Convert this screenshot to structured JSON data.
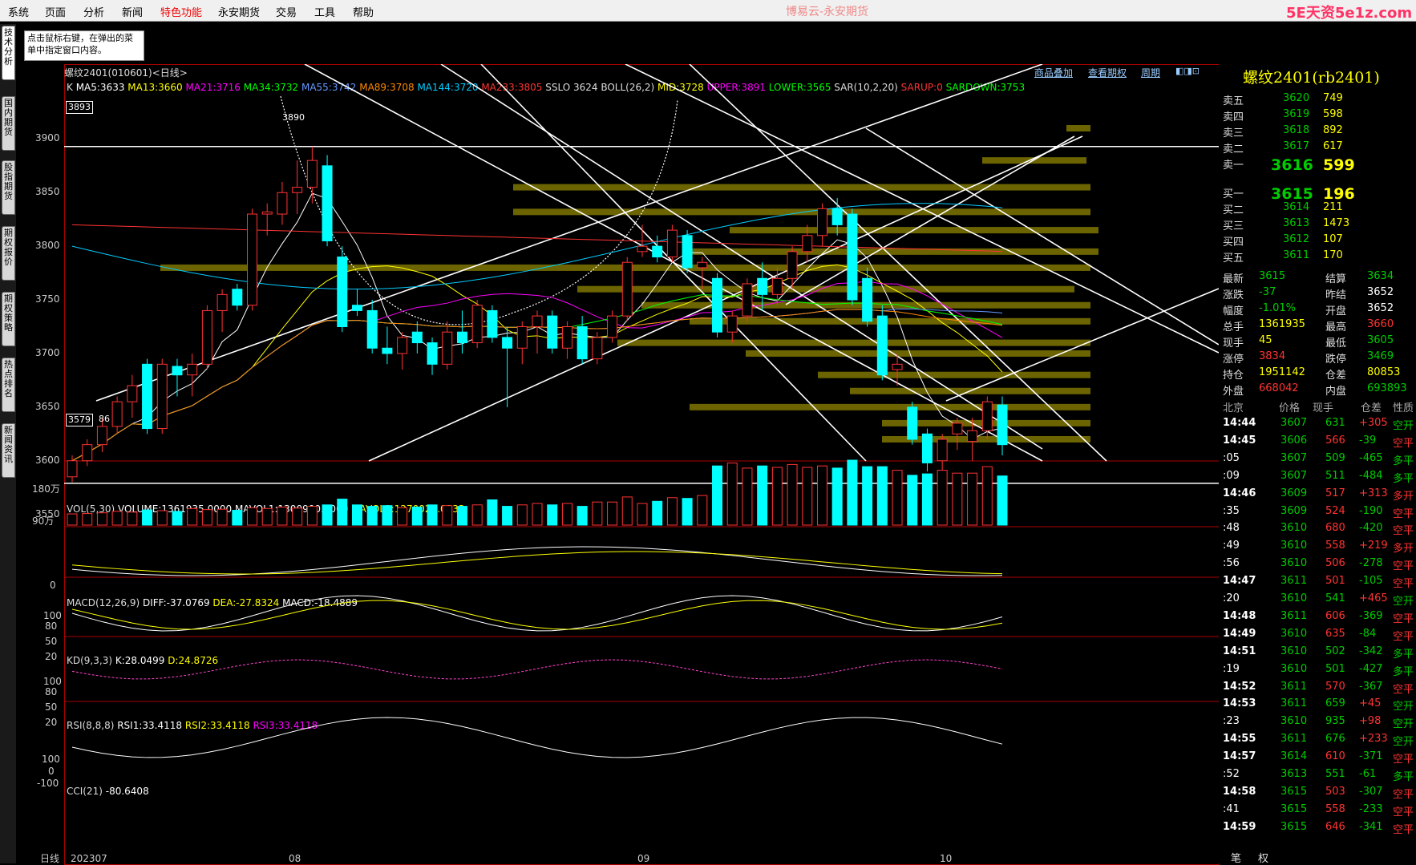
{
  "menu": {
    "items": [
      "系统",
      "页面",
      "分析",
      "新闻",
      "特色功能",
      "永安期货",
      "交易",
      "工具",
      "帮助"
    ],
    "highlight_index": 4,
    "app_title": "博易云-永安期货",
    "brand": "5E天资5e1z.com"
  },
  "hint": {
    "text": "点击鼠标右键，在弹出的菜单中指定窗口内容。"
  },
  "sidetabs": [
    "技术分析",
    "国内期货",
    "股指期货",
    "期权报价",
    "期权策略",
    "热点排名",
    "新闻资讯"
  ],
  "chart": {
    "title": "螺纹2401(010601)<日线>",
    "links": [
      "商品叠加",
      "查看期权",
      "周期"
    ],
    "indicators": [
      {
        "text": "K",
        "color": "#dddddd"
      },
      {
        "text": "MA5:3633",
        "color": "#ffffff"
      },
      {
        "text": "MA13:3660",
        "color": "#ffff00"
      },
      {
        "text": "MA21:3716",
        "color": "#ff00ff"
      },
      {
        "text": "MA34:3732",
        "color": "#00ff00"
      },
      {
        "text": "MA55:3742",
        "color": "#6699ff"
      },
      {
        "text": "MA89:3708",
        "color": "#ff8800"
      },
      {
        "text": "MA144:3720",
        "color": "#00ccff"
      },
      {
        "text": "MA233:3805",
        "color": "#ff3333"
      },
      {
        "text": "SSLO 3624",
        "color": "#dddddd"
      },
      {
        "text": "BOLL(26,2)",
        "color": "#dddddd"
      },
      {
        "text": "MID:3728",
        "color": "#ffff00"
      },
      {
        "text": "UPPER:3891",
        "color": "#ff00ff"
      },
      {
        "text": "LOWER:3565",
        "color": "#00ff00"
      },
      {
        "text": "SAR(10,2,20)",
        "color": "#dddddd"
      },
      {
        "text": "SARUP:0",
        "color": "#ff3333"
      },
      {
        "text": "SARDOWN:3753",
        "color": "#00ff00"
      }
    ],
    "price_axis": [
      "3900",
      "3850",
      "3800",
      "3750",
      "3700",
      "3650",
      "3600",
      "3550"
    ],
    "high_label": "3893",
    "high_marker": "3890",
    "low_label": "3579",
    "low_marker": "86",
    "vol_label": [
      {
        "text": "VOL(5,30)",
        "color": "#dddddd"
      },
      {
        "text": "VOLUME:1361935.0000",
        "color": "#ffffff"
      },
      {
        "text": "MAVOL1:1300900.8000",
        "color": "#ffffff"
      },
      {
        "text": "MAVOL2:1270022.0333",
        "color": "#ffff00"
      }
    ],
    "vol_axis": [
      "180万",
      "90万"
    ],
    "macd_label": [
      {
        "text": "MACD(12,26,9)",
        "color": "#dddddd"
      },
      {
        "text": "DIFF:-37.0769",
        "color": "#ffffff"
      },
      {
        "text": "DEA:-27.8324",
        "color": "#ffff00"
      },
      {
        "text": "MACD:-18.4889",
        "color": "#ffffff"
      }
    ],
    "macd_axis": [
      "0"
    ],
    "kd_label": [
      {
        "text": "KD(9,3,3)",
        "color": "#dddddd"
      },
      {
        "text": "K:28.0499",
        "color": "#ffffff"
      },
      {
        "text": "D:24.8726",
        "color": "#ffff00"
      }
    ],
    "kd_axis": [
      "100",
      "80",
      "50",
      "20"
    ],
    "rsi_label": [
      {
        "text": "RSI(8,8,8)",
        "color": "#dddddd"
      },
      {
        "text": "RSI1:33.4118",
        "color": "#ffffff"
      },
      {
        "text": "RSI2:33.4118",
        "color": "#ffff00"
      },
      {
        "text": "RSI3:33.4118",
        "color": "#ff00ff"
      }
    ],
    "rsi_axis": [
      "100",
      "80",
      "50",
      "20"
    ],
    "cci_label": [
      {
        "text": "CCI(21)",
        "color": "#dddddd"
      },
      {
        "text": "-80.6408",
        "color": "#ffffff"
      }
    ],
    "cci_axis": [
      "100",
      "0",
      "-100"
    ],
    "date_axis": {
      "period": "日线",
      "labels": [
        "202307",
        "08",
        "09",
        "10"
      ]
    }
  },
  "quote": {
    "title": "螺纹2401(rb2401)",
    "asks": [
      {
        "label": "卖五",
        "price": "3620",
        "vol": "749"
      },
      {
        "label": "卖四",
        "price": "3619",
        "vol": "598"
      },
      {
        "label": "卖三",
        "price": "3618",
        "vol": "892"
      },
      {
        "label": "卖二",
        "price": "3617",
        "vol": "617"
      },
      {
        "label": "卖一",
        "price": "3616",
        "vol": "599"
      }
    ],
    "bids": [
      {
        "label": "买一",
        "price": "3615",
        "vol": "196"
      },
      {
        "label": "买二",
        "price": "3614",
        "vol": "211"
      },
      {
        "label": "买三",
        "price": "3613",
        "vol": "1473"
      },
      {
        "label": "买四",
        "price": "3612",
        "vol": "107"
      },
      {
        "label": "买五",
        "price": "3611",
        "vol": "170"
      }
    ],
    "stats": [
      {
        "l1": "最新",
        "v1": "3615",
        "c1": "#00cc00",
        "l2": "结算",
        "v2": "3634",
        "c2": "#00cc00"
      },
      {
        "l1": "涨跌",
        "v1": "-37",
        "c1": "#00cc00",
        "l2": "昨结",
        "v2": "3652",
        "c2": "#ffffff"
      },
      {
        "l1": "幅度",
        "v1": "-1.01%",
        "c1": "#00cc00",
        "l2": "开盘",
        "v2": "3652",
        "c2": "#ffffff"
      },
      {
        "l1": "总手",
        "v1": "1361935",
        "c1": "#ffff00",
        "l2": "最高",
        "v2": "3660",
        "c2": "#ff3333"
      },
      {
        "l1": "现手",
        "v1": "45",
        "c1": "#ffff00",
        "l2": "最低",
        "v2": "3605",
        "c2": "#00cc00"
      },
      {
        "l1": "涨停",
        "v1": "3834",
        "c1": "#ff3333",
        "l2": "跌停",
        "v2": "3469",
        "c2": "#00cc00"
      },
      {
        "l1": "持仓",
        "v1": "1951142",
        "c1": "#ffff00",
        "l2": "仓差",
        "v2": "80853",
        "c2": "#ffff00"
      },
      {
        "l1": "外盘",
        "v1": "668042",
        "c1": "#ff3333",
        "l2": "内盘",
        "v2": "693893",
        "c2": "#00cc00"
      }
    ],
    "tick_header": [
      "北京",
      "价格",
      "现手",
      "仓差",
      "性质"
    ],
    "ticks": [
      {
        "time": "14:44",
        "price": "3607",
        "vol": "631",
        "oi": "+305",
        "nature": "空开",
        "vc": "#00cc00",
        "oc": "#ff3333",
        "nc": "#00cc00"
      },
      {
        "time": "14:45",
        "price": "3606",
        "vol": "566",
        "oi": "-39",
        "nature": "空平",
        "vc": "#ff3333",
        "oc": "#00cc00",
        "nc": "#ff3333"
      },
      {
        "time": ":05",
        "price": "3607",
        "vol": "509",
        "oi": "-465",
        "nature": "多平",
        "vc": "#00cc00",
        "oc": "#00cc00",
        "nc": "#00cc00"
      },
      {
        "time": ":09",
        "price": "3607",
        "vol": "511",
        "oi": "-484",
        "nature": "多平",
        "vc": "#00cc00",
        "oc": "#00cc00",
        "nc": "#00cc00"
      },
      {
        "time": "14:46",
        "price": "3609",
        "vol": "517",
        "oi": "+313",
        "nature": "多开",
        "vc": "#ff3333",
        "oc": "#ff3333",
        "nc": "#ff3333"
      },
      {
        "time": ":35",
        "price": "3609",
        "vol": "524",
        "oi": "-190",
        "nature": "空平",
        "vc": "#ff3333",
        "oc": "#00cc00",
        "nc": "#ff3333"
      },
      {
        "time": ":48",
        "price": "3610",
        "vol": "680",
        "oi": "-420",
        "nature": "空平",
        "vc": "#ff3333",
        "oc": "#00cc00",
        "nc": "#ff3333"
      },
      {
        "time": ":49",
        "price": "3610",
        "vol": "558",
        "oi": "+219",
        "nature": "多开",
        "vc": "#ff3333",
        "oc": "#ff3333",
        "nc": "#ff3333"
      },
      {
        "time": ":56",
        "price": "3610",
        "vol": "506",
        "oi": "-278",
        "nature": "空平",
        "vc": "#ff3333",
        "oc": "#00cc00",
        "nc": "#ff3333"
      },
      {
        "time": "14:47",
        "price": "3611",
        "vol": "501",
        "oi": "-105",
        "nature": "空平",
        "vc": "#ff3333",
        "oc": "#00cc00",
        "nc": "#ff3333"
      },
      {
        "time": ":20",
        "price": "3610",
        "vol": "541",
        "oi": "+465",
        "nature": "空开",
        "vc": "#00cc00",
        "oc": "#ff3333",
        "nc": "#00cc00"
      },
      {
        "time": "14:48",
        "price": "3611",
        "vol": "606",
        "oi": "-369",
        "nature": "空平",
        "vc": "#ff3333",
        "oc": "#00cc00",
        "nc": "#ff3333"
      },
      {
        "time": "14:49",
        "price": "3610",
        "vol": "635",
        "oi": "-84",
        "nature": "空平",
        "vc": "#ff3333",
        "oc": "#00cc00",
        "nc": "#ff3333"
      },
      {
        "time": "14:51",
        "price": "3610",
        "vol": "502",
        "oi": "-342",
        "nature": "多平",
        "vc": "#00cc00",
        "oc": "#00cc00",
        "nc": "#00cc00"
      },
      {
        "time": ":19",
        "price": "3610",
        "vol": "501",
        "oi": "-427",
        "nature": "多平",
        "vc": "#00cc00",
        "oc": "#00cc00",
        "nc": "#00cc00"
      },
      {
        "time": "14:52",
        "price": "3611",
        "vol": "570",
        "oi": "-367",
        "nature": "空平",
        "vc": "#ff3333",
        "oc": "#00cc00",
        "nc": "#ff3333"
      },
      {
        "time": "14:53",
        "price": "3611",
        "vol": "659",
        "oi": "+45",
        "nature": "空开",
        "vc": "#00cc00",
        "oc": "#ff3333",
        "nc": "#00cc00"
      },
      {
        "time": ":23",
        "price": "3610",
        "vol": "935",
        "oi": "+98",
        "nature": "空开",
        "vc": "#00cc00",
        "oc": "#ff3333",
        "nc": "#00cc00"
      },
      {
        "time": "14:55",
        "price": "3611",
        "vol": "676",
        "oi": "+233",
        "nature": "空开",
        "vc": "#00cc00",
        "oc": "#ff3333",
        "nc": "#00cc00"
      },
      {
        "time": "14:57",
        "price": "3614",
        "vol": "610",
        "oi": "-371",
        "nature": "空平",
        "vc": "#ff3333",
        "oc": "#00cc00",
        "nc": "#ff3333"
      },
      {
        "time": ":52",
        "price": "3613",
        "vol": "551",
        "oi": "-61",
        "nature": "多平",
        "vc": "#00cc00",
        "oc": "#00cc00",
        "nc": "#00cc00"
      },
      {
        "time": "14:58",
        "price": "3615",
        "vol": "503",
        "oi": "-307",
        "nature": "空平",
        "vc": "#ff3333",
        "oc": "#00cc00",
        "nc": "#ff3333"
      },
      {
        "time": ":41",
        "price": "3615",
        "vol": "558",
        "oi": "-233",
        "nature": "空平",
        "vc": "#ff3333",
        "oc": "#00cc00",
        "nc": "#ff3333"
      },
      {
        "time": "14:59",
        "price": "3615",
        "vol": "646",
        "oi": "-341",
        "nature": "空平",
        "vc": "#ff3333",
        "oc": "#00cc00",
        "nc": "#ff3333"
      }
    ],
    "bottom_tabs": [
      "笔",
      "权"
    ]
  },
  "chart_data": {
    "type": "candlestick",
    "instrument": "螺纹2401",
    "ylim": [
      3540,
      3910
    ],
    "candles": [
      {
        "o": 3585,
        "h": 3605,
        "l": 3580,
        "c": 3600
      },
      {
        "o": 3600,
        "h": 3620,
        "l": 3595,
        "c": 3615
      },
      {
        "o": 3615,
        "h": 3640,
        "l": 3608,
        "c": 3632
      },
      {
        "o": 3632,
        "h": 3660,
        "l": 3625,
        "c": 3655
      },
      {
        "o": 3655,
        "h": 3680,
        "l": 3640,
        "c": 3670
      },
      {
        "o": 3690,
        "h": 3695,
        "l": 3625,
        "c": 3630
      },
      {
        "o": 3630,
        "h": 3695,
        "l": 3625,
        "c": 3690
      },
      {
        "o": 3688,
        "h": 3695,
        "l": 3660,
        "c": 3680
      },
      {
        "o": 3680,
        "h": 3700,
        "l": 3660,
        "c": 3690
      },
      {
        "o": 3690,
        "h": 3745,
        "l": 3685,
        "c": 3740
      },
      {
        "o": 3740,
        "h": 3760,
        "l": 3720,
        "c": 3755
      },
      {
        "o": 3760,
        "h": 3765,
        "l": 3740,
        "c": 3745
      },
      {
        "o": 3745,
        "h": 3835,
        "l": 3740,
        "c": 3830
      },
      {
        "o": 3830,
        "h": 3840,
        "l": 3810,
        "c": 3832
      },
      {
        "o": 3830,
        "h": 3860,
        "l": 3820,
        "c": 3850
      },
      {
        "o": 3850,
        "h": 3880,
        "l": 3830,
        "c": 3855
      },
      {
        "o": 3855,
        "h": 3893,
        "l": 3840,
        "c": 3880
      },
      {
        "o": 3875,
        "h": 3885,
        "l": 3800,
        "c": 3805
      },
      {
        "o": 3790,
        "h": 3800,
        "l": 3720,
        "c": 3725
      },
      {
        "o": 3745,
        "h": 3760,
        "l": 3735,
        "c": 3740
      },
      {
        "o": 3740,
        "h": 3750,
        "l": 3700,
        "c": 3705
      },
      {
        "o": 3705,
        "h": 3725,
        "l": 3690,
        "c": 3700
      },
      {
        "o": 3700,
        "h": 3720,
        "l": 3685,
        "c": 3715
      },
      {
        "o": 3720,
        "h": 3730,
        "l": 3700,
        "c": 3710
      },
      {
        "o": 3710,
        "h": 3715,
        "l": 3680,
        "c": 3690
      },
      {
        "o": 3690,
        "h": 3730,
        "l": 3685,
        "c": 3720
      },
      {
        "o": 3720,
        "h": 3740,
        "l": 3700,
        "c": 3710
      },
      {
        "o": 3710,
        "h": 3750,
        "l": 3705,
        "c": 3745
      },
      {
        "o": 3740,
        "h": 3745,
        "l": 3710,
        "c": 3715
      },
      {
        "o": 3715,
        "h": 3725,
        "l": 3650,
        "c": 3705
      },
      {
        "o": 3705,
        "h": 3730,
        "l": 3690,
        "c": 3725
      },
      {
        "o": 3725,
        "h": 3740,
        "l": 3700,
        "c": 3735
      },
      {
        "o": 3735,
        "h": 3740,
        "l": 3700,
        "c": 3705
      },
      {
        "o": 3705,
        "h": 3730,
        "l": 3695,
        "c": 3725
      },
      {
        "o": 3725,
        "h": 3735,
        "l": 3690,
        "c": 3695
      },
      {
        "o": 3695,
        "h": 3720,
        "l": 3690,
        "c": 3715
      },
      {
        "o": 3715,
        "h": 3740,
        "l": 3710,
        "c": 3735
      },
      {
        "o": 3735,
        "h": 3790,
        "l": 3730,
        "c": 3785
      },
      {
        "o": 3795,
        "h": 3820,
        "l": 3790,
        "c": 3800
      },
      {
        "o": 3800,
        "h": 3810,
        "l": 3785,
        "c": 3790
      },
      {
        "o": 3790,
        "h": 3820,
        "l": 3785,
        "c": 3815
      },
      {
        "o": 3810,
        "h": 3815,
        "l": 3775,
        "c": 3780
      },
      {
        "o": 3780,
        "h": 3790,
        "l": 3760,
        "c": 3785
      },
      {
        "o": 3770,
        "h": 3775,
        "l": 3715,
        "c": 3720
      },
      {
        "o": 3720,
        "h": 3740,
        "l": 3710,
        "c": 3735
      },
      {
        "o": 3735,
        "h": 3770,
        "l": 3730,
        "c": 3765
      },
      {
        "o": 3770,
        "h": 3785,
        "l": 3740,
        "c": 3755
      },
      {
        "o": 3755,
        "h": 3780,
        "l": 3745,
        "c": 3770
      },
      {
        "o": 3770,
        "h": 3800,
        "l": 3760,
        "c": 3795
      },
      {
        "o": 3795,
        "h": 3820,
        "l": 3785,
        "c": 3810
      },
      {
        "o": 3810,
        "h": 3840,
        "l": 3800,
        "c": 3835
      },
      {
        "o": 3835,
        "h": 3845,
        "l": 3810,
        "c": 3820
      },
      {
        "o": 3830,
        "h": 3835,
        "l": 3745,
        "c": 3750
      },
      {
        "o": 3770,
        "h": 3780,
        "l": 3725,
        "c": 3730
      },
      {
        "o": 3735,
        "h": 3745,
        "l": 3675,
        "c": 3680
      },
      {
        "o": 3685,
        "h": 3700,
        "l": 3670,
        "c": 3690
      },
      {
        "o": 3650,
        "h": 3655,
        "l": 3615,
        "c": 3620
      },
      {
        "o": 3625,
        "h": 3630,
        "l": 3590,
        "c": 3598
      },
      {
        "o": 3600,
        "h": 3625,
        "l": 3590,
        "c": 3620
      },
      {
        "o": 3625,
        "h": 3640,
        "l": 3610,
        "c": 3635
      },
      {
        "o": 3618,
        "h": 3640,
        "l": 3600,
        "c": 3628
      },
      {
        "o": 3628,
        "h": 3660,
        "l": 3620,
        "c": 3655
      },
      {
        "o": 3652,
        "h": 3660,
        "l": 3605,
        "c": 3615
      }
    ],
    "volume": [
      310000,
      320000,
      340000,
      380000,
      360000,
      420000,
      400000,
      380000,
      460000,
      430000,
      440000,
      410000,
      480000,
      460000,
      500000,
      470000,
      520000,
      560000,
      720000,
      560000,
      520000,
      540000,
      480000,
      500000,
      560000,
      540000,
      520000,
      560000,
      700000,
      520000,
      560000,
      600000,
      560000,
      600000,
      520000,
      640000,
      640000,
      780000,
      600000,
      660000,
      760000,
      740000,
      820000,
      1640000,
      1720000,
      1580000,
      1640000,
      1600000,
      1680000,
      1600000,
      1640000,
      1580000,
      1800000,
      1620000,
      1620000,
      1520000,
      1380000,
      1420000,
      1520000,
      1440000,
      1440000,
      1620000,
      1361935
    ]
  }
}
